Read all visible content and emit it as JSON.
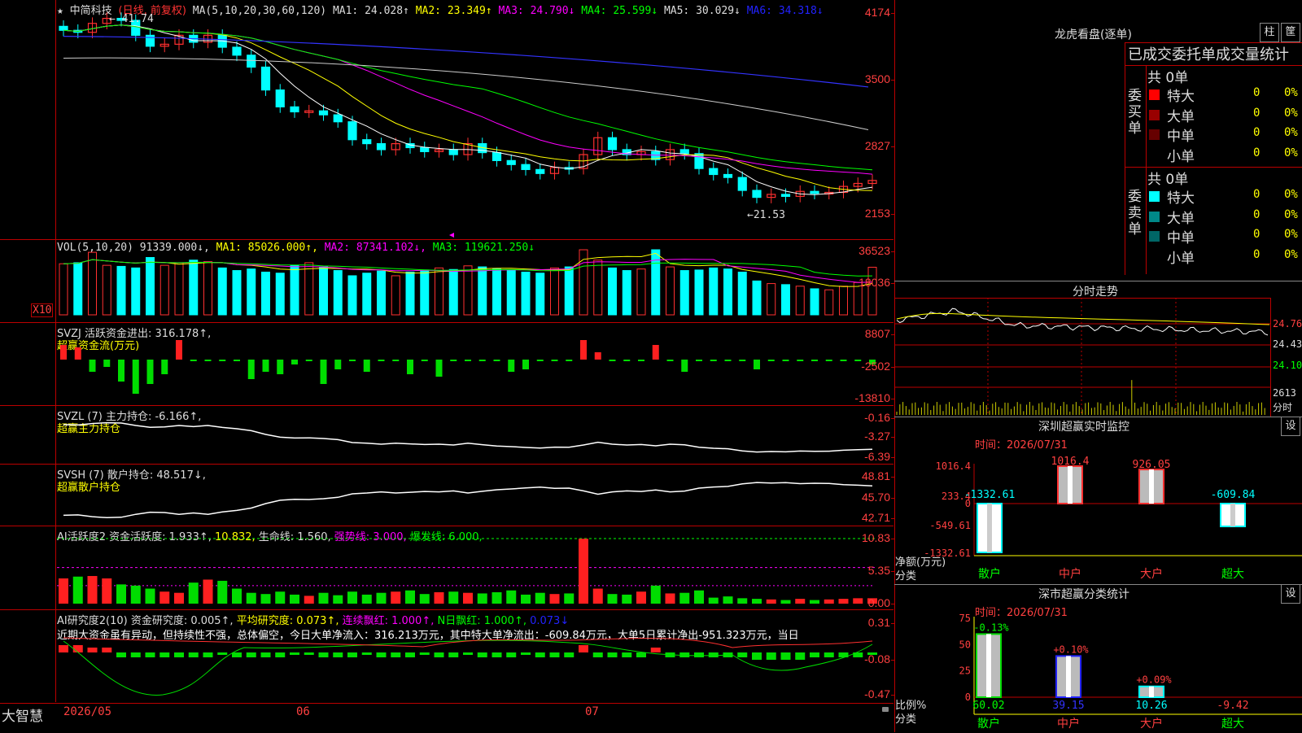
{
  "stock": {
    "star": "★",
    "name": "中简科技",
    "period": "(日线, 前复权)",
    "ma_header": [
      {
        "label": "MA(5,10,20,30,60,120)",
        "cls": "w"
      },
      {
        "label": "MA1: 24.028↑",
        "cls": "w"
      },
      {
        "label": "MA2: 23.349↑",
        "cls": "y"
      },
      {
        "label": "MA3: 24.790↓",
        "cls": "m"
      },
      {
        "label": "MA4: 25.599↓",
        "cls": "g"
      },
      {
        "label": "MA5: 30.029↓",
        "cls": "w"
      },
      {
        "label": "MA6: 34.318↓",
        "cls": "b"
      }
    ],
    "price_ticks": [
      "4174",
      "3500",
      "2827",
      "2153"
    ],
    "high_mark": "41.74",
    "low_mark": "21.53"
  },
  "vol": {
    "header": [
      {
        "label": "VOL(5,10,20)",
        "cls": "w"
      },
      {
        "label": "91339.000↓,",
        "cls": "w"
      },
      {
        "label": "MA1: 85026.000↑,",
        "cls": "y"
      },
      {
        "label": "MA2: 87341.102↓,",
        "cls": "m"
      },
      {
        "label": "MA3: 119621.250↓",
        "cls": "g"
      }
    ],
    "ticks": [
      "36523",
      "18036"
    ],
    "unit": "X10"
  },
  "svzj": {
    "header": "SVZJ  活跃资金进出: 316.178↑,",
    "sub": "超赢资金流(万元)",
    "ticks": [
      "8807",
      "-2502",
      "-13810"
    ]
  },
  "svzl": {
    "header": "SVZL (7) 主力持仓: -6.166↑,",
    "sub": "超赢主力持仓",
    "ticks": [
      "-0.16",
      "-3.27",
      "-6.39"
    ]
  },
  "svsh": {
    "header": "SVSH (7) 散户持仓: 48.517↓,",
    "sub": "超赢散户持仓",
    "ticks": [
      "48.81",
      "45.70",
      "42.71"
    ]
  },
  "ai2": {
    "header": [
      {
        "label": "AI活跃度2 资金活跃度: 1.933↑,",
        "cls": "w"
      },
      {
        "label": "10.832,",
        "cls": "y"
      },
      {
        "label": "生命线: 1.560,",
        "cls": "w"
      },
      {
        "label": "强势线: 3.000,",
        "cls": "m"
      },
      {
        "label": "爆发线: 6.000,",
        "cls": "g"
      }
    ],
    "ticks": [
      "10.83",
      "5.35",
      "0.00"
    ]
  },
  "ai_res": {
    "header": [
      {
        "label": "AI研究度2(10) 资金研究度: 0.005↑,",
        "cls": "w"
      },
      {
        "label": "平均研究度: 0.073↑,",
        "cls": "y"
      },
      {
        "label": "连续飘红: 1.000↑,",
        "cls": "m"
      },
      {
        "label": "N日飘红: 1.000↑,",
        "cls": "g"
      },
      {
        "label": "0.073↓",
        "cls": "b"
      }
    ],
    "note": "近期大资金虽有异动，但持续性不强，总体偏空，今日大单净流入：316.213万元，其中特大单净流出：-609.84万元，大单5日累计净出-951.323万元，当日",
    "ticks": [
      "0.31",
      "-0.08",
      "-0.47"
    ]
  },
  "footer": {
    "brand": "大智慧",
    "dates": [
      "2026/05",
      "06",
      "07"
    ]
  },
  "dragon": {
    "title": "龙虎看盘(逐单)",
    "btn1": "柱",
    "btn2": "筐",
    "stat_title": "已成交委托单成交量统计",
    "buy_label": "委买单",
    "sell_label": "委卖单",
    "buy_total": "共 0单",
    "sell_total": "共 0单",
    "buy_rows": [
      {
        "name": "特大",
        "qty": "0",
        "pct": "0%",
        "color": "#ff0000"
      },
      {
        "name": "大单",
        "qty": "0",
        "pct": "0%",
        "color": "#990000"
      },
      {
        "name": "中单",
        "qty": "0",
        "pct": "0%",
        "color": "#660000"
      },
      {
        "name": "小单",
        "qty": "0",
        "pct": "0%",
        "color": "#000000"
      }
    ],
    "sell_rows": [
      {
        "name": "特大",
        "qty": "0",
        "pct": "0%",
        "color": "#00ffff"
      },
      {
        "name": "大单",
        "qty": "0",
        "pct": "0%",
        "color": "#008888"
      },
      {
        "name": "中单",
        "qty": "0",
        "pct": "0%",
        "color": "#006666"
      },
      {
        "name": "小单",
        "qty": "0",
        "pct": "0%",
        "color": "#000000"
      }
    ]
  },
  "intraday": {
    "title": "分时走势",
    "ticks": [
      "24.76",
      "24.43",
      "24.10"
    ],
    "vol_tick": "2613",
    "vol_unit": "分时"
  },
  "monitor": {
    "title": "深圳超赢实时监控",
    "btn": "设",
    "time": "时间：2026/07/31",
    "ticks": [
      "1016.4",
      "233.4",
      "0",
      "-549.61",
      "-1332.61"
    ],
    "y_label": "净额(万元)",
    "x_label": "分类",
    "bars": [
      {
        "cat": "散户",
        "value": -1332.61,
        "label": "-1332.61"
      },
      {
        "cat": "中户",
        "value": 1016.4,
        "label": "1016.4"
      },
      {
        "cat": "大户",
        "value": 926.05,
        "label": "926.05"
      },
      {
        "cat": "超大",
        "value": -609.84,
        "label": "-609.84"
      }
    ]
  },
  "classify": {
    "title": "深市超赢分类统计",
    "btn": "设",
    "time": "时间：2026/07/31",
    "ticks": [
      "75",
      "50",
      "25",
      "0"
    ],
    "y_label": "比例%",
    "x_label": "分类",
    "bars": [
      {
        "cat": "散户",
        "value": 60.02,
        "label": "60.02",
        "change": "-0.13%"
      },
      {
        "cat": "中户",
        "value": 39.15,
        "label": "39.15",
        "change": "+0.10%"
      },
      {
        "cat": "大户",
        "value": 10.26,
        "label": "10.26",
        "change": "+0.09%"
      },
      {
        "cat": "超大",
        "value": -9.42,
        "label": "-9.42",
        "change": ""
      }
    ]
  },
  "chart_data": [
    {
      "type": "line",
      "title": "中简科技 日线",
      "series": [
        {
          "name": "close",
          "values": [
            40.0,
            39.8,
            40.7,
            41.2,
            41.0,
            39.5,
            38.4,
            38.6,
            39.5,
            38.8,
            39.5,
            38.3,
            37.5,
            36.3,
            34.0,
            32.3,
            31.8,
            31.9,
            31.5,
            30.8,
            29.0,
            28.6,
            28.0,
            28.6,
            28.2,
            27.8,
            28.0,
            27.5,
            28.6,
            27.7,
            26.9,
            26.5,
            26.0,
            25.6,
            26.2,
            26.1,
            27.5,
            29.2,
            28.0,
            27.5,
            27.8,
            27.0,
            28.0,
            27.6,
            26.1,
            25.5,
            25.2,
            23.9,
            23.2,
            23.5,
            23.3,
            23.8,
            23.6,
            23.7,
            24.3,
            24.6,
            24.9
          ]
        },
        {
          "name": "MA6",
          "values": [
            37.9,
            34.3
          ]
        }
      ]
    },
    {
      "type": "bar",
      "title": "VOL",
      "series": [
        {
          "name": "VOL",
          "values": [
            98000,
            100000,
            120000,
            95000,
            93000,
            90000,
            110000,
            95000,
            100000,
            105000,
            102000,
            90000,
            85000,
            88000,
            82000,
            80000,
            95000,
            100000,
            92000,
            85000,
            75000,
            80000,
            84000,
            75000,
            82000,
            86000,
            90000,
            87000,
            94000,
            92000,
            88000,
            85000,
            82000,
            80000,
            90000,
            92000,
            210000,
            105000,
            90000,
            85000,
            88000,
            130000,
            92000,
            85000,
            86000,
            90000,
            88000,
            82000,
            65000,
            60000,
            58000,
            55000,
            50000,
            48000,
            55000,
            62000,
            91339
          ]
        }
      ]
    }
  ]
}
